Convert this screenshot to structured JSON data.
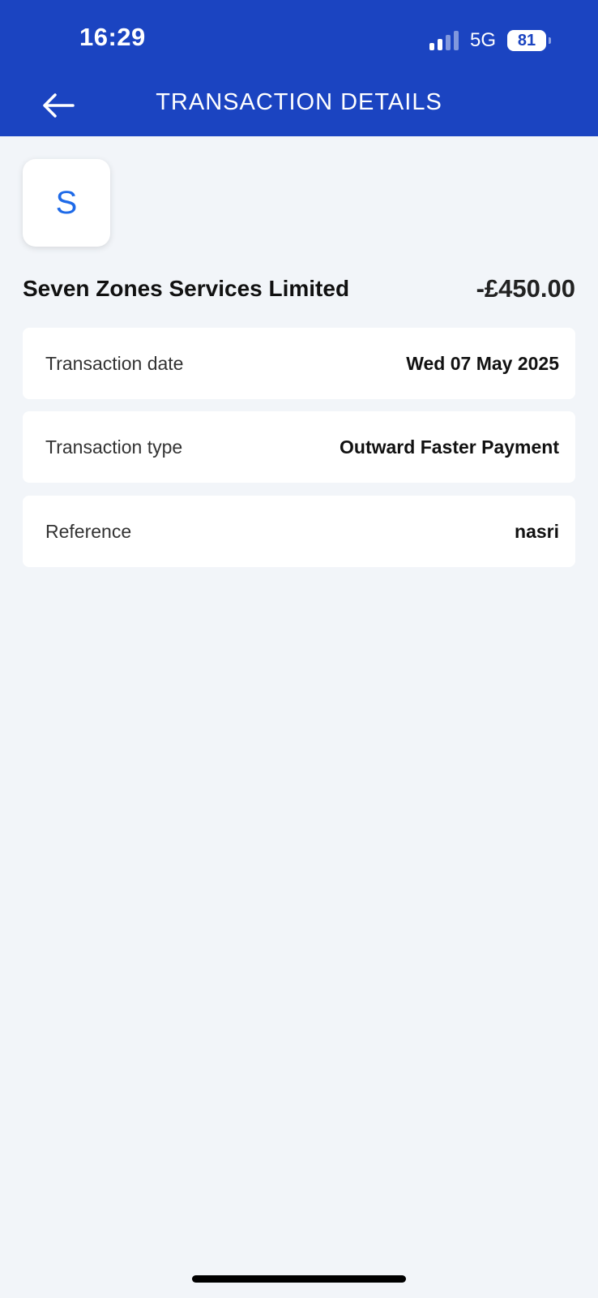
{
  "status_bar": {
    "time": "16:29",
    "network": "5G",
    "battery": "81"
  },
  "header": {
    "title": "TRANSACTION DETAILS",
    "back_icon": "arrow-left-icon"
  },
  "transaction": {
    "avatar_letter": "S",
    "merchant_name": "Seven Zones Services Limited",
    "amount": "-£450.00",
    "details": [
      {
        "label": "Transaction date",
        "value": "Wed 07 May 2025"
      },
      {
        "label": "Transaction type",
        "value": "Outward Faster Payment"
      },
      {
        "label": "Reference",
        "value": "nasri"
      }
    ]
  },
  "colors": {
    "header_bg": "#1b44c1",
    "page_bg": "#f2f5f9",
    "avatar_letter": "#1e6ae8"
  }
}
